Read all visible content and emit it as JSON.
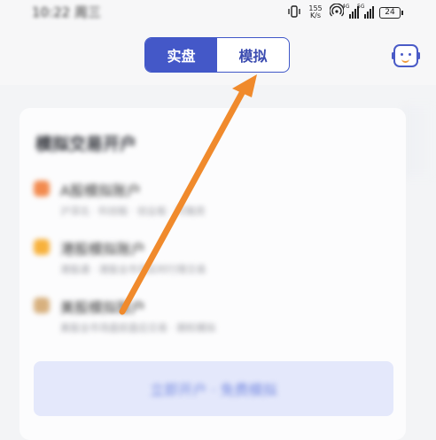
{
  "status_bar": {
    "time": "10:22 周三",
    "net_speed_value": "155",
    "net_speed_unit": "K/s",
    "signal_1_tag": "4G",
    "signal_2_tag": "5G",
    "battery_level": "24",
    "icons": [
      "vibrate-icon",
      "hotspot-icon",
      "signal-icon",
      "battery-icon"
    ]
  },
  "header": {
    "tabs": [
      {
        "label": "实盘",
        "active": true
      },
      {
        "label": "模拟",
        "active": false
      }
    ],
    "assistant_icon": "robot-assistant-icon"
  },
  "card": {
    "title": "模拟交易开户",
    "accounts": [
      {
        "name": "A股模拟账户",
        "desc": "沪深北 · 科创板 · 创业板 · 可融资",
        "icon_color": "#f28a4e"
      },
      {
        "name": "港股模拟账户",
        "desc": "港股通 · 港股全市场实时行情交易",
        "icon_color": "#f7b13c"
      },
      {
        "name": "美股模拟账户",
        "desc": "美股全市场盘前盘后交易 · 期权模拟",
        "icon_color": "#d7b07e"
      }
    ],
    "open_button_label": "立即开户 · 免费模拟"
  },
  "annotation": {
    "color": "#f08a2c",
    "meaning": "arrow pointing to the 模拟 tab"
  }
}
